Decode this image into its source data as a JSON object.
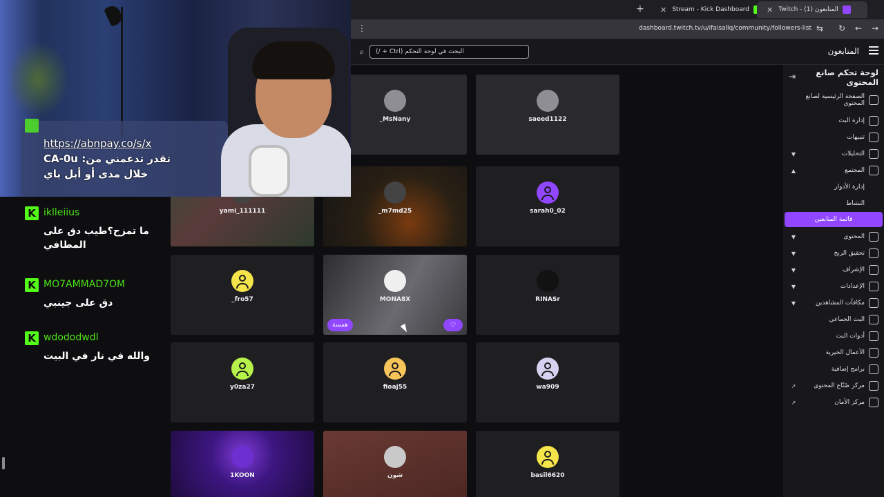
{
  "browser": {
    "tabs": [
      {
        "label": "Twitch - المتابعون (1)",
        "active": true
      },
      {
        "label": "Stream - Kick Dashboard",
        "active": false
      }
    ],
    "url": "dashboard.twitch.tv/u/ifaisallq/community/followers-list"
  },
  "topbar": {
    "title": "المتابعون",
    "search_placeholder": "البحث في لوحة التحكم (Ctrl + /)"
  },
  "sidebar": {
    "title": "لوحة تحكم صانع المحتوى",
    "items": [
      {
        "label": "الصفحة الرئيسية لصانع المحتوى",
        "icon": "home-icon",
        "chevron": false
      },
      {
        "label": "إدارة البث",
        "icon": "broadcast-icon",
        "chevron": false
      },
      {
        "label": "تنبيهات",
        "icon": "megaphone-icon",
        "chevron": false
      },
      {
        "label": "التحليلات",
        "icon": "analytics-icon",
        "chevron": "down"
      },
      {
        "label": "المجتمع",
        "icon": "community-icon",
        "chevron": "up"
      },
      {
        "label": "إدارة الأدوار",
        "icon": "",
        "chevron": false
      },
      {
        "label": "النشاط",
        "icon": "",
        "chevron": false
      },
      {
        "label": "قائمة المتابعين",
        "icon": "",
        "chevron": false
      },
      {
        "label": "المحتوى",
        "icon": "content-icon",
        "chevron": "down"
      },
      {
        "label": "تحقيق الربح",
        "icon": "monetization-icon",
        "chevron": "down"
      },
      {
        "label": "الإشراف",
        "icon": "moderation-icon",
        "chevron": "down"
      },
      {
        "label": "الإعدادات",
        "icon": "gear-icon",
        "chevron": "down"
      },
      {
        "label": "مكافآت المشاهدين",
        "icon": "rewards-icon",
        "chevron": "down"
      },
      {
        "label": "البث الجماعي",
        "icon": "collab-icon",
        "chevron": false
      },
      {
        "label": "أدوات البث",
        "icon": "tools-icon",
        "chevron": false
      },
      {
        "label": "الأعمال الخيرية",
        "icon": "charity-icon",
        "chevron": false
      },
      {
        "label": "برامج إضافية",
        "icon": "extensions-icon",
        "chevron": false
      },
      {
        "label": "مركز صُنّاع المحتوى",
        "icon": "book-icon",
        "chevron": false,
        "external": true
      },
      {
        "label": "مركز الأمان",
        "icon": "shield-icon",
        "chevron": false,
        "external": true
      }
    ]
  },
  "followers": [
    {
      "name": "_MsNany"
    },
    {
      "name": "saeed1122"
    },
    {
      "name": "yami_111111"
    },
    {
      "name": "_m7md25"
    },
    {
      "name": "sarah0_02"
    },
    {
      "name": "_fro57"
    },
    {
      "name": "MONA8X"
    },
    {
      "name": "RINASr"
    },
    {
      "name": "y0za27"
    },
    {
      "name": "fioaj55"
    },
    {
      "name": "wa909"
    },
    {
      "name": "1KOON"
    },
    {
      "name": "شون"
    },
    {
      "name": "basil6620"
    }
  ],
  "card_actions": {
    "whisper": "همسة"
  },
  "chat": [
    {
      "user": "iklleiius",
      "text": "ما تمزح؟طيب دق على المطافي"
    },
    {
      "user": "MO7AMMAD7OM",
      "text": "دق على جينبي"
    },
    {
      "user": "wdododwdl",
      "text": "والله في نار في البيت"
    }
  ],
  "cam_overlay": {
    "link": "https://abnpay.co/s/x",
    "line1": "تقدر تدعمني من: CA-0u",
    "line2": "خلال مدى أو أبل باي"
  },
  "colors": {
    "accent": "#9147ff",
    "kick_green": "#53fc18",
    "background": "#0e0e10"
  }
}
